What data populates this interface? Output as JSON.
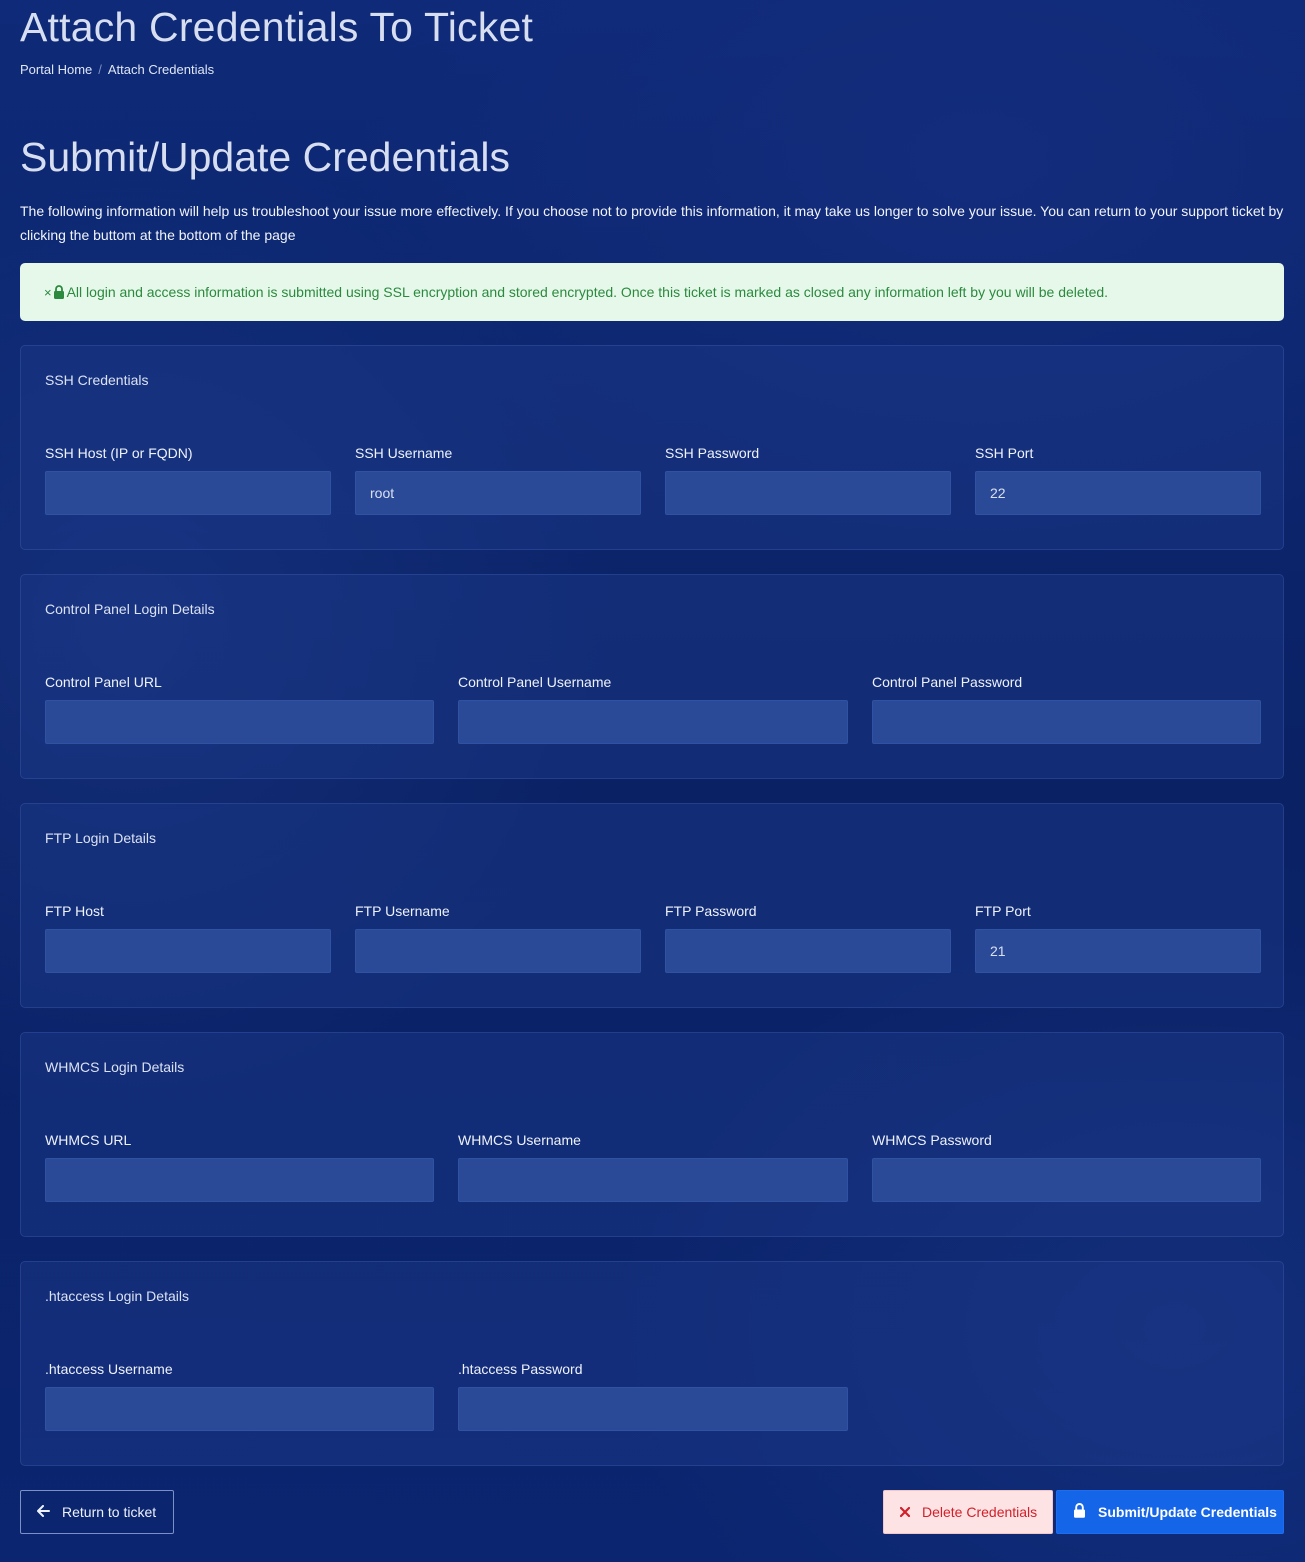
{
  "header": {
    "title": "Attach Credentials To Ticket",
    "breadcrumb": [
      {
        "label": "Portal Home"
      },
      {
        "label": "Attach Credentials"
      }
    ],
    "breadcrumb_separator": "/"
  },
  "main": {
    "section_title": "Submit/Update Credentials",
    "intro": "The following information will help us troubleshoot your issue more effectively. If you choose not to provide this information, it may take us longer to solve your issue. You can return to your support ticket by clicking the buttom at the bottom of the page",
    "alert": {
      "close_glyph": "×",
      "icon": "lock-icon",
      "text": "All login and access information is submitted using SSL encryption and stored encrypted. Once this ticket is marked as closed any information left by you will be deleted.",
      "color": "#2b8a3e",
      "background": "#e6f8ea"
    },
    "sections": {
      "ssh": {
        "title": "SSH Credentials",
        "fields": [
          {
            "label": "SSH Host (IP or FQDN)",
            "value": ""
          },
          {
            "label": "SSH Username",
            "value": "root"
          },
          {
            "label": "SSH Password",
            "value": ""
          },
          {
            "label": "SSH Port",
            "value": "22"
          }
        ]
      },
      "cpanel": {
        "title": "Control Panel Login Details",
        "fields": [
          {
            "label": "Control Panel URL",
            "value": ""
          },
          {
            "label": "Control Panel Username",
            "value": ""
          },
          {
            "label": "Control Panel Password",
            "value": ""
          }
        ]
      },
      "ftp": {
        "title": "FTP Login Details",
        "fields": [
          {
            "label": "FTP Host",
            "value": ""
          },
          {
            "label": "FTP Username",
            "value": ""
          },
          {
            "label": "FTP Password",
            "value": ""
          },
          {
            "label": "FTP Port",
            "value": "21"
          }
        ]
      },
      "whmcs": {
        "title": "WHMCS Login Details",
        "fields": [
          {
            "label": "WHMCS URL",
            "value": ""
          },
          {
            "label": "WHMCS Username",
            "value": ""
          },
          {
            "label": "WHMCS Password",
            "value": ""
          }
        ]
      },
      "htaccess": {
        "title": ".htaccess Login Details",
        "fields": [
          {
            "label": ".htaccess Username",
            "value": ""
          },
          {
            "label": ".htaccess Password",
            "value": ""
          }
        ]
      }
    }
  },
  "actions": {
    "return_label": "Return to ticket",
    "delete_label": "Delete Credentials",
    "submit_label": "Submit/Update Credentials",
    "delete_color": "#d21f2b",
    "submit_color": "#1565e8"
  }
}
